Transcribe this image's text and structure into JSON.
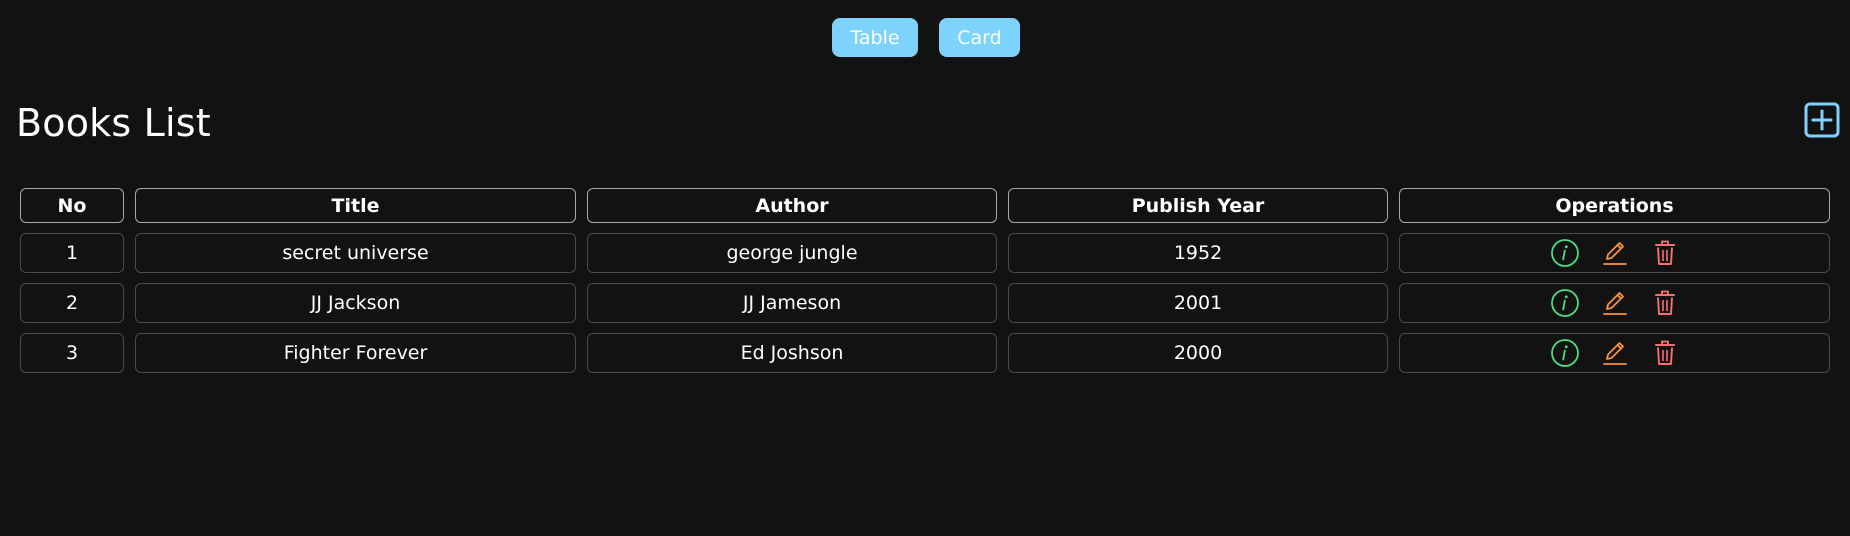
{
  "view_toggle": {
    "table_label": "Table",
    "card_label": "Card"
  },
  "page": {
    "title": "Books List"
  },
  "icons": {
    "add": "plus-square-icon",
    "info": "info-circle-icon",
    "edit": "pencil-icon",
    "delete": "trash-icon"
  },
  "colors": {
    "background": "#121212",
    "toggle_button": "#7dd3fc",
    "add_icon": "#7dd3fc",
    "info_icon": "#4ade80",
    "edit_icon": "#fb923c",
    "delete_icon": "#f87171"
  },
  "table": {
    "headers": [
      "No",
      "Title",
      "Author",
      "Publish Year",
      "Operations"
    ],
    "rows": [
      {
        "no": "1",
        "title": "secret universe",
        "author": "george jungle",
        "year": "1952"
      },
      {
        "no": "2",
        "title": "JJ Jackson",
        "author": "JJ Jameson",
        "year": "2001"
      },
      {
        "no": "3",
        "title": "Fighter Forever",
        "author": "Ed Joshson",
        "year": "2000"
      }
    ]
  }
}
